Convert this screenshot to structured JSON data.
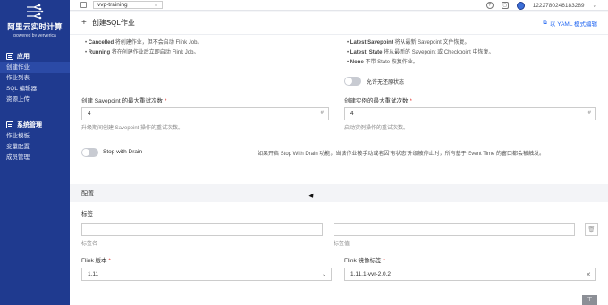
{
  "brand": {
    "title": "阿里云实时计算",
    "subtitle": "powered by ververica"
  },
  "sidebar": {
    "section_app": "应用",
    "app_items": [
      "创建作业",
      "作业列表",
      "SQL 编辑器",
      "资源上传"
    ],
    "section_system": "系统管理",
    "system_items": [
      "作业模板",
      "变量配置",
      "成员管理"
    ]
  },
  "topbar": {
    "workspace": "vvp-training",
    "account": "1222780246183289"
  },
  "header": {
    "title": "创建SQL作业",
    "yaml_link": "以 YAML 模式编辑"
  },
  "form": {
    "left_bullets": [
      {
        "key": "Cancelled",
        "text": " 将创建作业，但不会启动 Flink Job。"
      },
      {
        "key": "Running",
        "text": " 将在创建作业后立即启动 Flink Job。"
      }
    ],
    "right_bullets": [
      {
        "key": "Latest Savepoint",
        "text": " 将从最新 Savepoint 文件恢复。"
      },
      {
        "key": "Latest, State",
        "text": " 将从最新的 Savepoint 或 Checkpoint 中恢复。"
      },
      {
        "key": "None",
        "text": " 不带 State 恢复作业。"
      }
    ],
    "allow_no_state_label": "允许无还原状态",
    "savepoint_retry_label": "创建 Savepoint 的最大重试次数",
    "savepoint_retry_value": "4",
    "savepoint_retry_hint": "升级期间创建 Savepoint 操作的重试次数。",
    "instance_retry_label": "创建实例的最大重试次数",
    "instance_retry_value": "4",
    "instance_retry_hint": "启动实例操作的重试次数。",
    "stop_with_drain_label": "Stop with Drain",
    "stop_with_drain_desc": "如果开启 Stop With Drain 功能，当该作业被手动或者因'有状态'升级被停止时，所有基于 Event Time 的窗口都会被触发。",
    "config_section": "配置",
    "tags_label": "标签",
    "tag_name_hint": "标签名",
    "tag_value_hint": "标签值",
    "flink_version_label": "Flink 版本",
    "flink_version_value": "1.11",
    "flink_image_label": "Flink 镜像标签",
    "flink_image_value": "1.11.1-vvr-2.0.2",
    "required_mark": "*",
    "number_suffix": "#"
  }
}
